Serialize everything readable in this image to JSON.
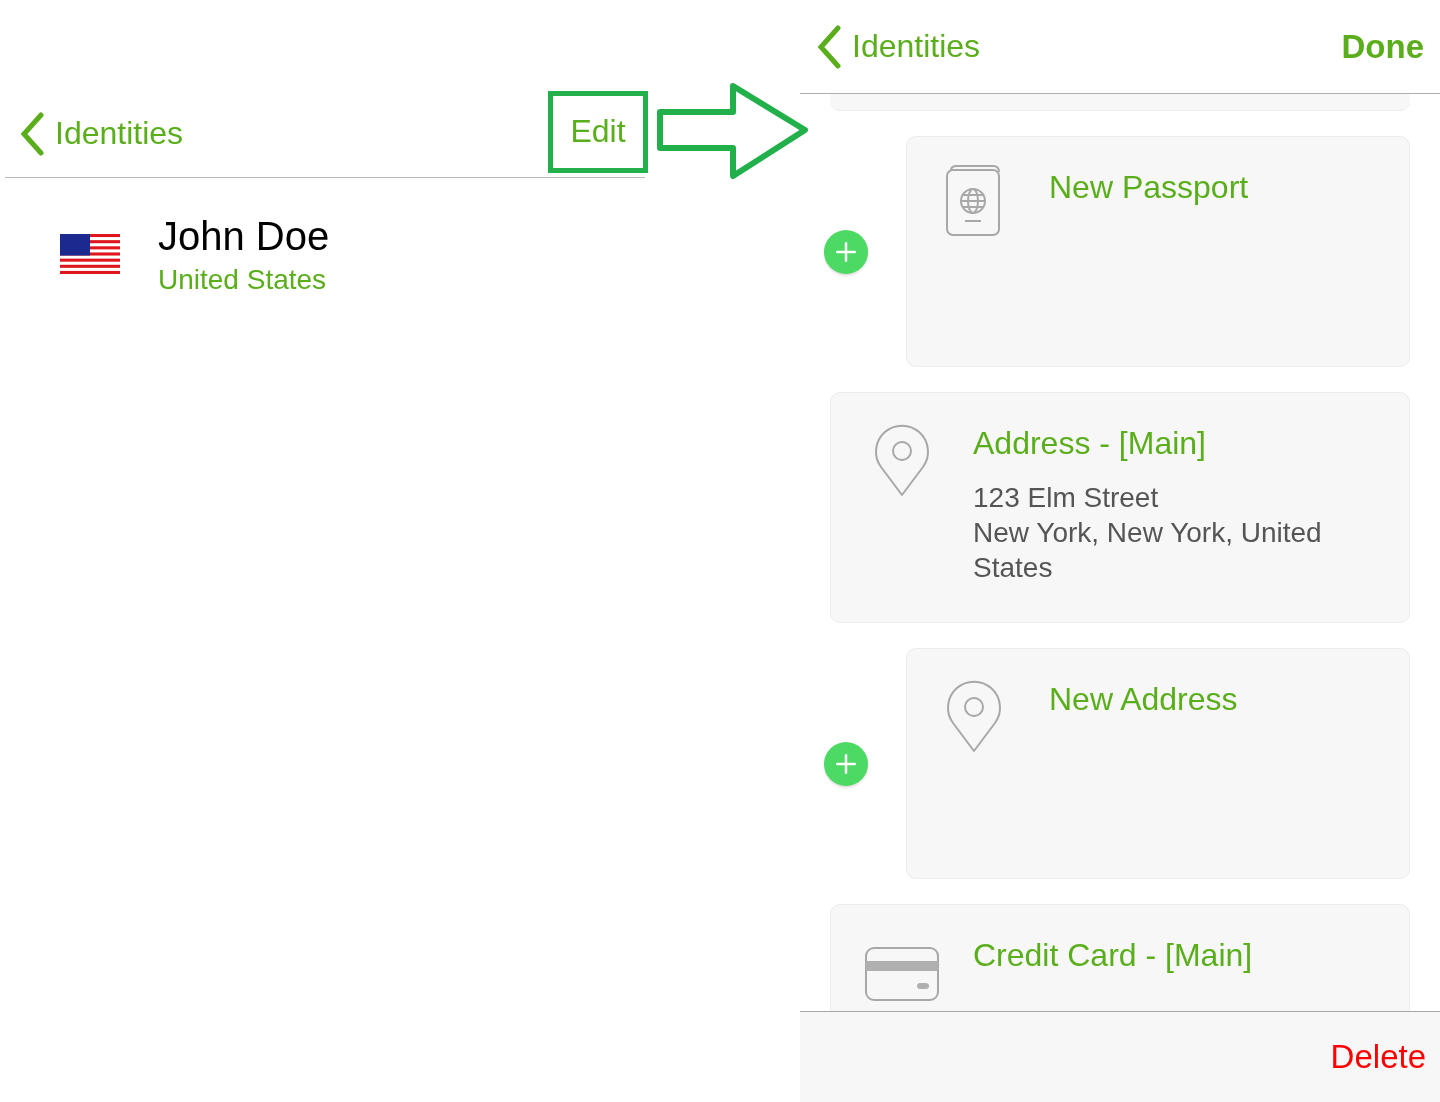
{
  "left_screen": {
    "nav": {
      "back_label": "Identities",
      "edit_label": "Edit"
    },
    "identities": [
      {
        "name": "John Doe",
        "country": "United States"
      }
    ]
  },
  "right_screen": {
    "nav": {
      "back_label": "Identities",
      "done_label": "Done"
    },
    "cards": [
      {
        "kind": "passport",
        "is_new": true,
        "title": "New Passport"
      },
      {
        "kind": "address",
        "is_new": false,
        "title": "Address - [Main]",
        "lines": [
          "123 Elm Street",
          "New York, New York, United States"
        ]
      },
      {
        "kind": "address",
        "is_new": true,
        "title": "New Address"
      },
      {
        "kind": "card",
        "is_new": false,
        "title": "Credit Card - [Main]"
      }
    ],
    "delete_label": "Delete"
  }
}
